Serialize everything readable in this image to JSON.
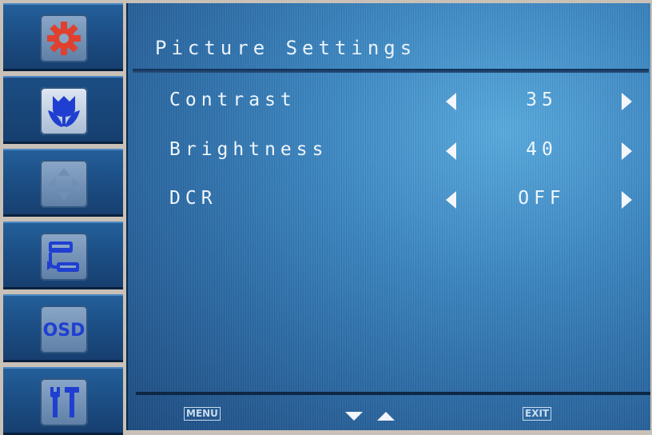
{
  "osd": {
    "title": "Picture Settings",
    "sidebar": {
      "items": [
        {
          "icon": "gear-icon",
          "selected": false
        },
        {
          "icon": "tulip-icon",
          "selected": true
        },
        {
          "icon": "position-arrows-icon",
          "selected": false
        },
        {
          "icon": "input-source-icon",
          "selected": false
        },
        {
          "icon": "osd-icon",
          "label": "OSD",
          "selected": false
        },
        {
          "icon": "tools-icon",
          "selected": false
        }
      ]
    },
    "settings": [
      {
        "label": "Contrast",
        "value": "35"
      },
      {
        "label": "Brightness",
        "value": "40"
      },
      {
        "label": "DCR",
        "value": "OFF"
      }
    ],
    "footer": {
      "menu_label": "MENU",
      "exit_label": "EXIT"
    },
    "colors": {
      "panel_blue": "#3f8ac4",
      "rail_blue": "#1c4f86",
      "text": "#eef5fc",
      "gear_red": "#e0402e",
      "icon_blue": "#1f3fd0"
    }
  }
}
